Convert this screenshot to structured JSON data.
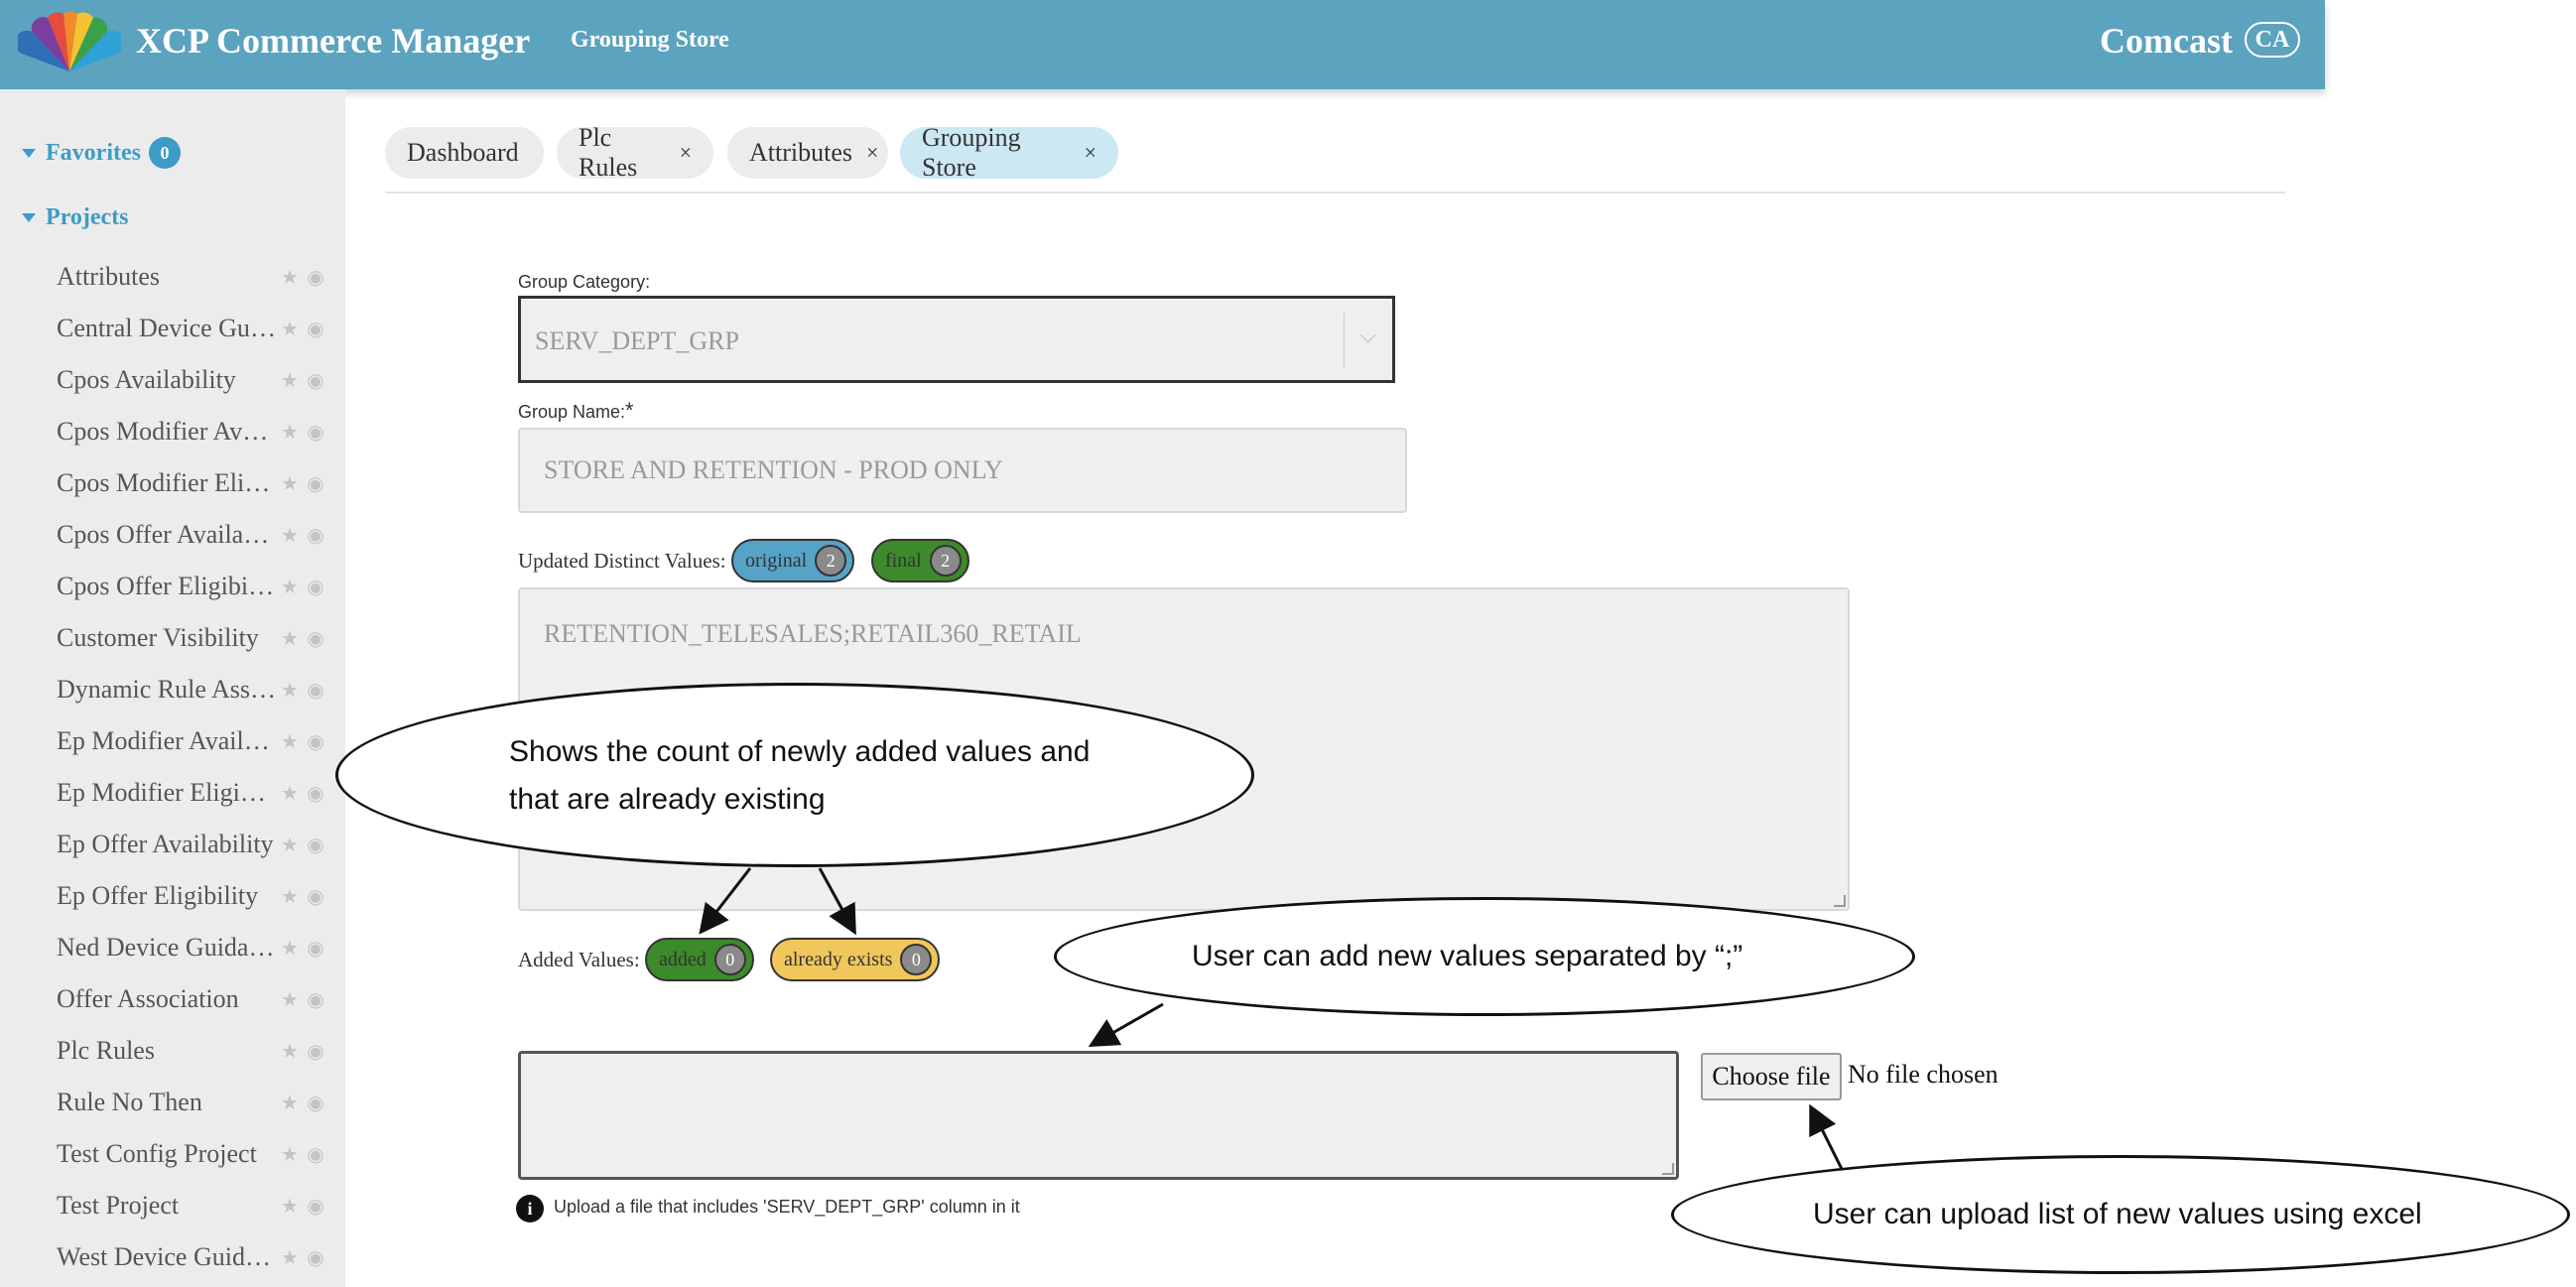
{
  "header": {
    "app_title": "XCP Commerce Manager",
    "nav_label": "Grouping Store",
    "org_name": "Comcast",
    "avatar_initials": "CA",
    "bg_color": "#5ba3bf"
  },
  "sidebar": {
    "favorites_label": "Favorites",
    "favorites_count": "0",
    "projects_label": "Projects",
    "items": [
      {
        "label": "Attributes"
      },
      {
        "label": "Central Device Guidance"
      },
      {
        "label": "Cpos Availability"
      },
      {
        "label": "Cpos Modifier Availability"
      },
      {
        "label": "Cpos Modifier Eligibility"
      },
      {
        "label": "Cpos Offer Availability"
      },
      {
        "label": "Cpos Offer Eligibility"
      },
      {
        "label": "Customer Visibility"
      },
      {
        "label": "Dynamic Rule Assignment"
      },
      {
        "label": "Ep Modifier Availability"
      },
      {
        "label": "Ep Modifier Eligibility"
      },
      {
        "label": "Ep Offer Availability"
      },
      {
        "label": "Ep Offer Eligibility"
      },
      {
        "label": "Ned Device Guidance"
      },
      {
        "label": "Offer Association"
      },
      {
        "label": "Plc Rules"
      },
      {
        "label": "Rule No Then"
      },
      {
        "label": "Test Config Project"
      },
      {
        "label": "Test Project"
      },
      {
        "label": "West Device Guidance"
      }
    ]
  },
  "tabs": [
    {
      "label": "Dashboard",
      "closable": false
    },
    {
      "label": "Plc Rules",
      "closable": true
    },
    {
      "label": "Attributes",
      "closable": true
    },
    {
      "label": "Grouping Store",
      "closable": true,
      "active": true
    }
  ],
  "form": {
    "group_category_label": "Group Category:",
    "group_category_value": "SERV_DEPT_GRP",
    "group_name_label": "Group Name:",
    "group_name_required": "*",
    "group_name_value": "STORE AND RETENTION - PROD ONLY",
    "updated_values_label": "Updated Distinct Values:",
    "original_badge": {
      "label": "original",
      "count": "2",
      "color": "#55a3c7"
    },
    "final_badge": {
      "label": "final",
      "count": "2",
      "color": "#3d8a2a"
    },
    "distinct_values": "RETENTION_TELESALES;RETAIL360_RETAIL",
    "added_values_label": "Added Values:",
    "added_badge": {
      "label": "added",
      "count": "0",
      "color": "#3d8a2a"
    },
    "exists_badge": {
      "label": "already exists",
      "count": "0",
      "color": "#f0c75a"
    },
    "new_values_text": "",
    "choose_file_label": "Choose file",
    "file_status": "No file chosen",
    "upload_hint": "Upload a file that includes 'SERV_DEPT_GRP' column in it",
    "info_icon_glyph": "i"
  },
  "callouts": {
    "count_line1": "Shows the count of newly added values and",
    "count_line2": "that are already existing",
    "separator": "User can add new values separated by “;”",
    "upload": "User can upload list of new values using excel"
  }
}
